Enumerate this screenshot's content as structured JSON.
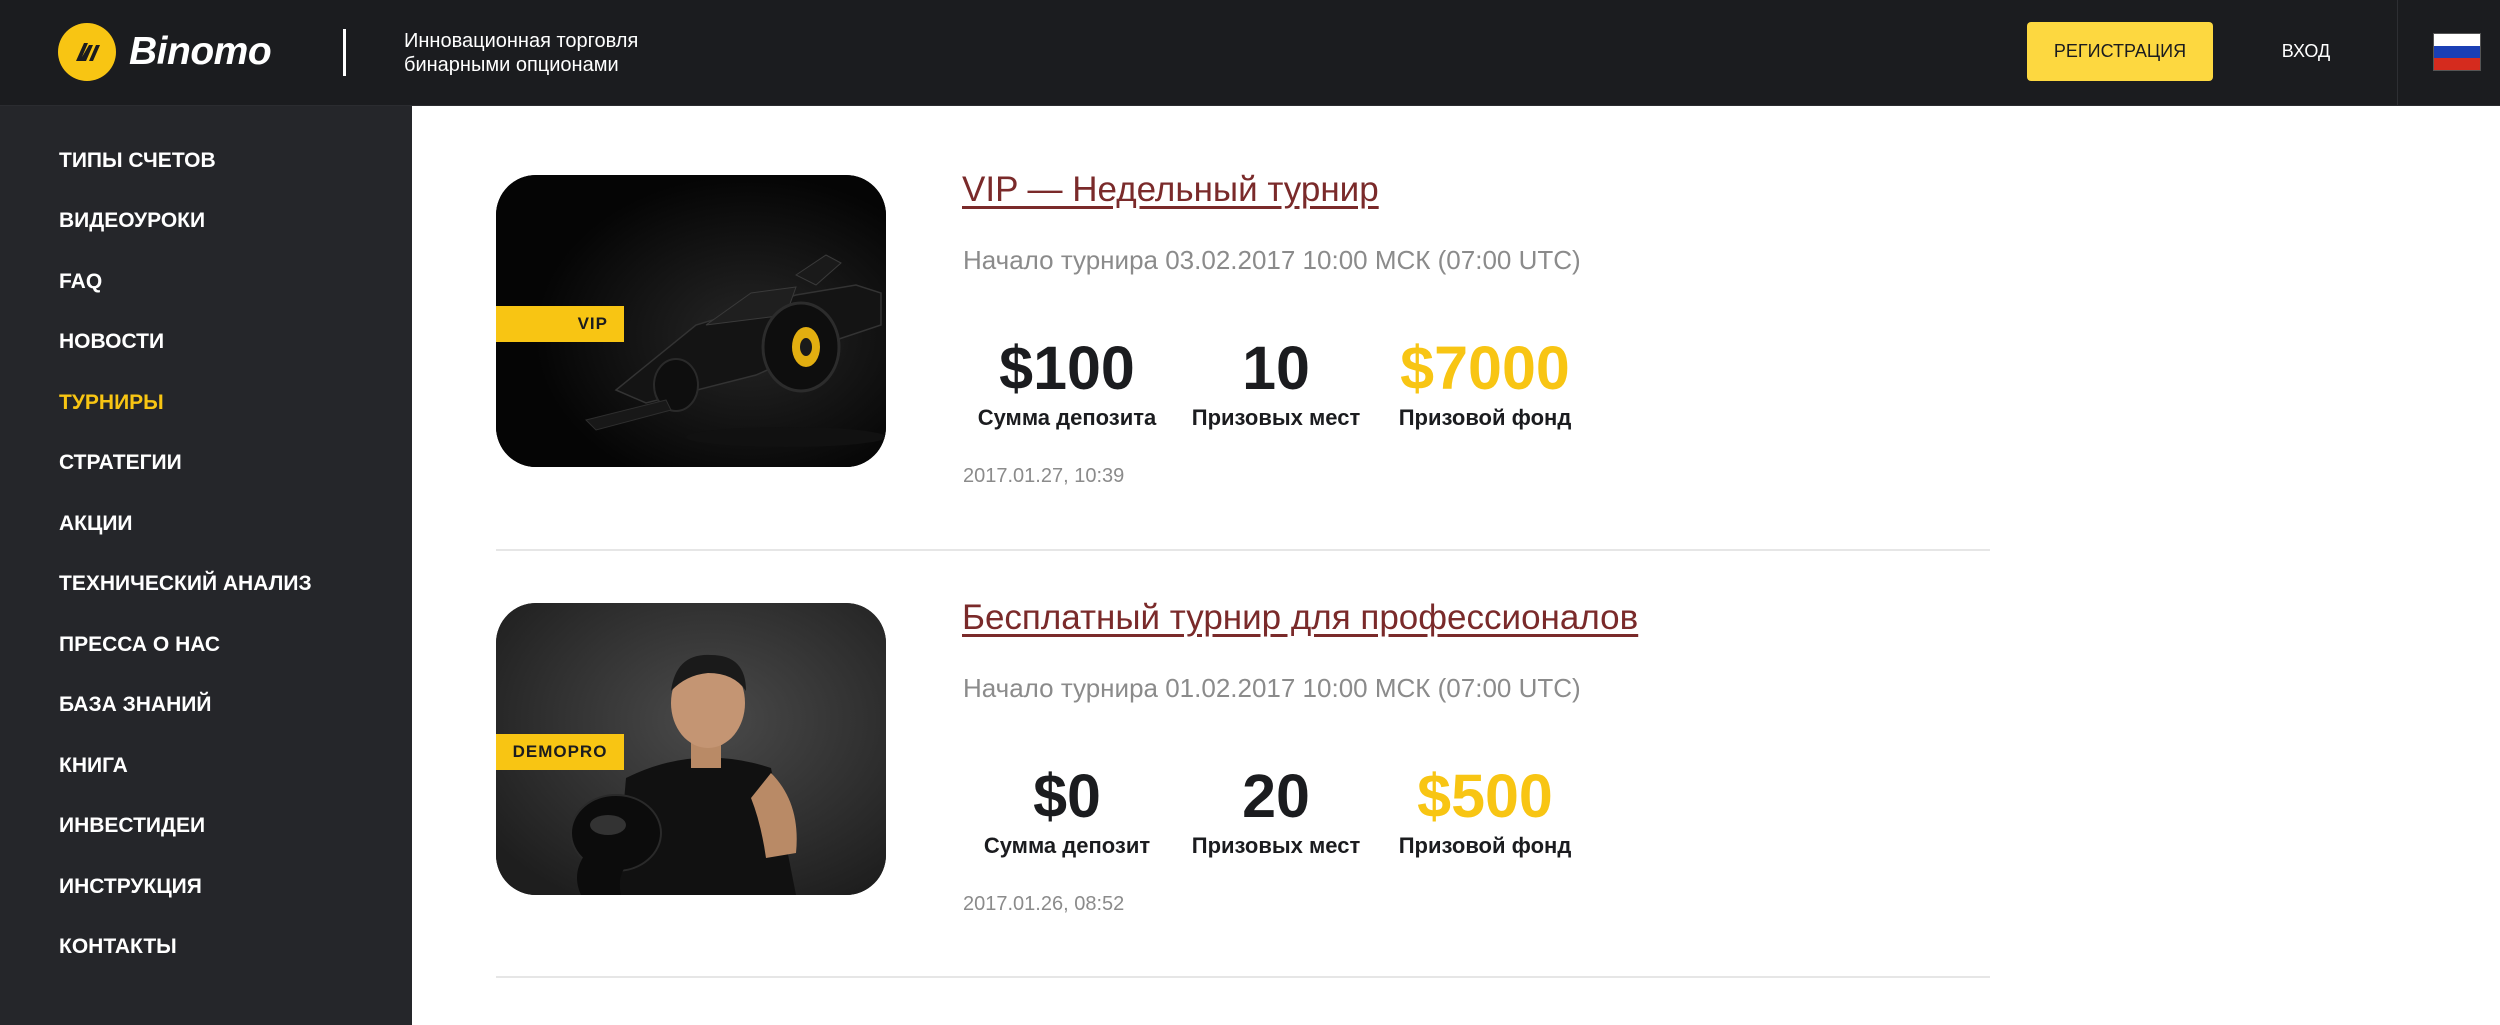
{
  "header": {
    "logo_text": "Binomo",
    "tagline": "Инновационная торговля бинарными опционами",
    "register_label": "РЕГИСТРАЦИЯ",
    "login_label": "ВХОД",
    "language_icon": "flag-ru-icon"
  },
  "sidebar": {
    "items": [
      {
        "label": "ТИПЫ СЧЕТОВ"
      },
      {
        "label": "ВИДЕОУРОКИ"
      },
      {
        "label": "FAQ"
      },
      {
        "label": "НОВОСТИ"
      },
      {
        "label": "ТУРНИРЫ",
        "active": true
      },
      {
        "label": "СТРАТЕГИИ"
      },
      {
        "label": "АКЦИИ"
      },
      {
        "label": "ТЕХНИЧЕСКИЙ АНАЛИЗ"
      },
      {
        "label": "ПРЕССА О НАС"
      },
      {
        "label": "БАЗА ЗНАНИЙ"
      },
      {
        "label": "КНИГА"
      },
      {
        "label": "ИНВЕСТИДЕИ"
      },
      {
        "label": "ИНСТРУКЦИЯ"
      },
      {
        "label": "КОНТАКТЫ"
      }
    ]
  },
  "tournaments": [
    {
      "badge": "VIP",
      "title": "VIP — Недельный турнир",
      "start": "Начало турнира 03.02.2017 10:00 МСК (07:00 UTC)",
      "deposit_value": "$100",
      "deposit_label": "Сумма депозита",
      "places_value": "10",
      "places_label": "Призовых мест",
      "fund_value": "$7000",
      "fund_label": "Призовой фонд",
      "date": "2017.01.27, 10:39"
    },
    {
      "badge": "DEMOPRO",
      "title": "Бесплатный турнир для профессионалов",
      "start": "Начало турнира 01.02.2017 10:00 МСК (07:00 UTC)",
      "deposit_value": "$0",
      "deposit_label": "Сумма депозит",
      "places_value": "20",
      "places_label": "Призовых мест",
      "fund_value": "$500",
      "fund_label": "Призовой фонд",
      "date": "2017.01.26, 08:52"
    }
  ],
  "colors": {
    "accent": "#f8c513",
    "header_bg": "#1b1c1f",
    "sidebar_bg": "#25262a",
    "title_link": "#7a2a2a"
  }
}
